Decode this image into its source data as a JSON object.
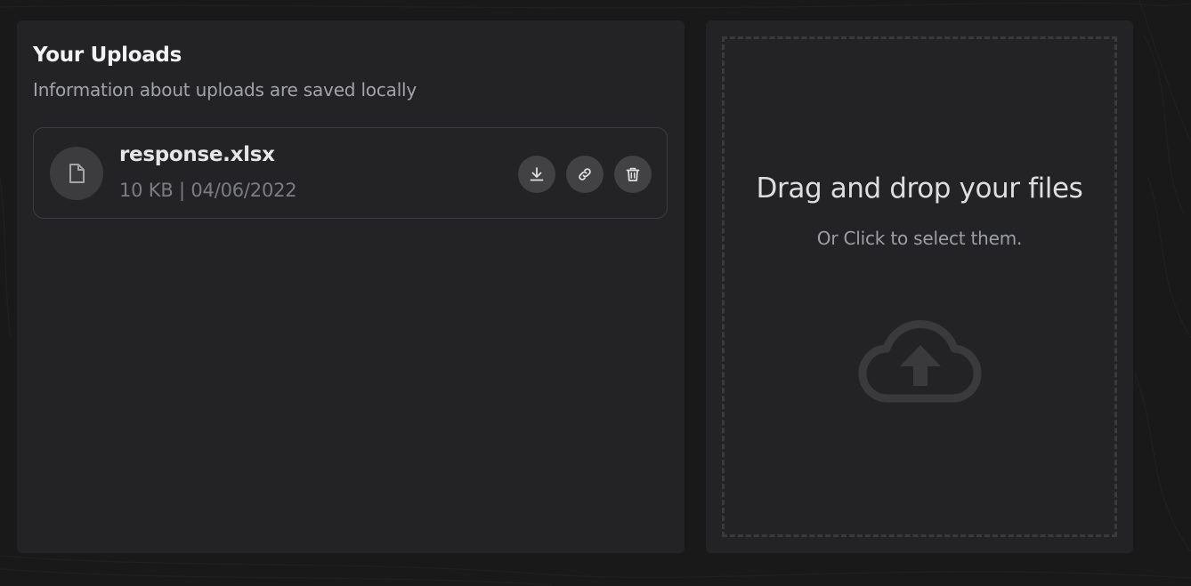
{
  "uploads": {
    "title": "Your Uploads",
    "subtitle": "Information about uploads are saved locally",
    "files": [
      {
        "name": "response.xlsx",
        "meta": "10 KB | 04/06/2022",
        "icon": "file-icon",
        "actions": [
          "download-icon",
          "link-icon",
          "trash-icon"
        ]
      }
    ]
  },
  "dropzone": {
    "title": "Drag and drop your files",
    "subtitle": "Or Click to select them.",
    "icon": "cloud-upload-icon"
  },
  "colors": {
    "background": "#19191a",
    "panel": "#232325",
    "card_border": "#3c3d41",
    "button_bg": "#424244",
    "dashed_border": "#3a3a3c"
  }
}
